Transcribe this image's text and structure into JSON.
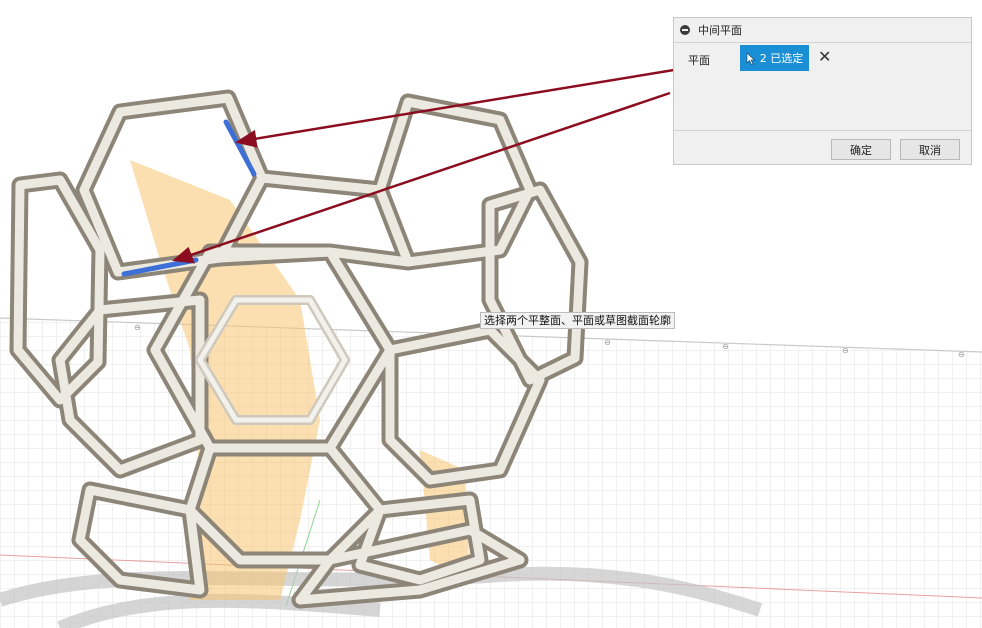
{
  "panel": {
    "title": "中间平面",
    "row_label": "平面",
    "selection_label": "2 已选定",
    "ok_label": "确定",
    "cancel_label": "取消"
  },
  "tooltip": "选择两个平整面、平面或草图截面轮廓",
  "colors": {
    "accent": "#1b8fd6",
    "arrow": "#8b0d1f",
    "highlight_edge": "#3d6fd6",
    "plane": "#f7c46f"
  },
  "icons": [
    "collapse-icon",
    "cursor-icon",
    "close-icon"
  ]
}
